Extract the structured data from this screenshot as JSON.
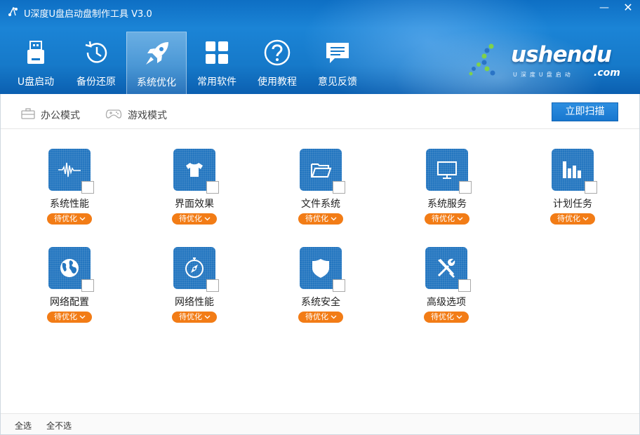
{
  "window": {
    "title": "U深度U盘启动盘制作工具 V3.0",
    "minimize_glyph": "—",
    "close_glyph": "✕"
  },
  "nav": [
    {
      "label": "U盘启动",
      "icon": "usb-drive-icon"
    },
    {
      "label": "备份还原",
      "icon": "history-clock-icon"
    },
    {
      "label": "系统优化",
      "icon": "rocket-icon",
      "active": true
    },
    {
      "label": "常用软件",
      "icon": "apps-grid-icon"
    },
    {
      "label": "使用教程",
      "icon": "question-icon"
    },
    {
      "label": "意见反馈",
      "icon": "chat-bubble-icon"
    }
  ],
  "logo": {
    "text": "ushendu",
    "com": ".com",
    "sub": "U深度U盘启动"
  },
  "toolbar": {
    "office_mode": "办公模式",
    "game_mode": "游戏模式",
    "scan_button": "立即扫描"
  },
  "items": [
    {
      "label": "系统性能",
      "status": "待优化",
      "icon": "pulse-wave-icon"
    },
    {
      "label": "界面效果",
      "status": "待优化",
      "icon": "tshirt-icon"
    },
    {
      "label": "文件系统",
      "status": "待优化",
      "icon": "folder-icon"
    },
    {
      "label": "系统服务",
      "status": "待优化",
      "icon": "monitor-icon"
    },
    {
      "label": "计划任务",
      "status": "待优化",
      "icon": "bar-chart-icon"
    },
    {
      "label": "网络配置",
      "status": "待优化",
      "icon": "globe-icon"
    },
    {
      "label": "网络性能",
      "status": "待优化",
      "icon": "compass-icon"
    },
    {
      "label": "系统安全",
      "status": "待优化",
      "icon": "shield-icon"
    },
    {
      "label": "高级选项",
      "status": "待优化",
      "icon": "tools-icon"
    }
  ],
  "footer": {
    "select_all": "全选",
    "select_none": "全不选"
  },
  "colors": {
    "header_blue": "#1679c9",
    "tile_blue": "#2476c0",
    "badge_orange": "#f27c16"
  }
}
